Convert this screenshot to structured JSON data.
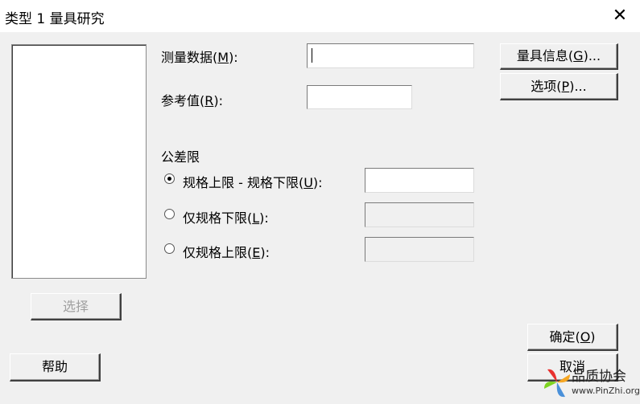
{
  "window": {
    "title": "类型 1 量具研究",
    "close_glyph": "✕"
  },
  "form": {
    "measure_label_pre": "测量数据(",
    "measure_label_key": "M",
    "measure_label_post": "):",
    "measure_value": "",
    "reference_label_pre": "参考值(",
    "reference_label_key": "R",
    "reference_label_post": "):",
    "reference_value": "",
    "tolerance_heading": "公差限",
    "option1_pre": "规格上限 - 规格下限(",
    "option1_key": "U",
    "option1_post": "):",
    "option2_pre": "仅规格下限(",
    "option2_key": "L",
    "option2_post": "):",
    "option3_pre": "仅规格上限(",
    "option3_key": "E",
    "option3_post": "):",
    "selected_option": 1
  },
  "buttons": {
    "gage_info_pre": "量具信息(",
    "gage_info_key": "G",
    "gage_info_post": ")...",
    "options_pre": "选项(",
    "options_key": "P",
    "options_post": ")...",
    "select": "选择",
    "help": "帮助",
    "ok_pre": "确定(",
    "ok_key": "O",
    "ok_post": ")",
    "cancel": "取消"
  },
  "watermark": {
    "text": "品质协会",
    "url": "www.PinZhi.org"
  }
}
